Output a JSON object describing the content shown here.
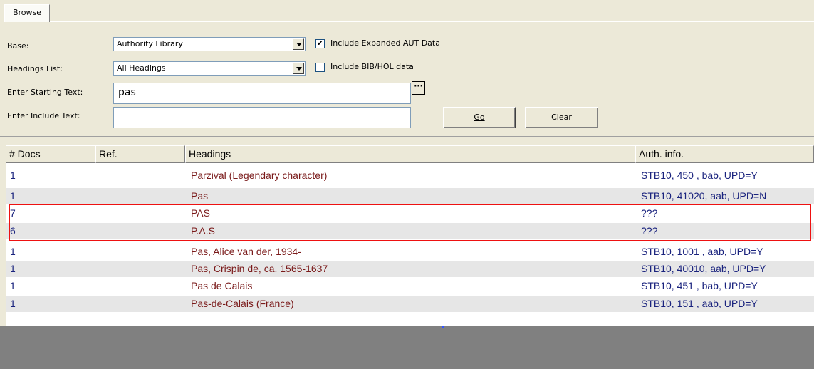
{
  "tabs": [
    "Browse"
  ],
  "form": {
    "base_label": "Base:",
    "base_value": "Authority Library",
    "headings_label": "Headings List:",
    "headings_value": "All Headings",
    "start_label": "Enter Starting Text:",
    "start_value": "pas",
    "include_label": "Enter Include Text:",
    "include_value": "",
    "chk_expanded_label": "Include Expanded AUT Data",
    "chk_expanded_checked": true,
    "chk_bib_label": "Include BIB/HOL data",
    "chk_bib_checked": false,
    "go_label": "Go",
    "clear_label": "Clear"
  },
  "grid": {
    "columns": [
      "# Docs",
      "Ref.",
      "Headings",
      "Auth. info."
    ],
    "rows": [
      {
        "docs": "1",
        "ref": "",
        "heading": "Parzival (Legendary character)",
        "auth": "STB10, 450 , bab, UPD=Y"
      },
      {
        "docs": "1",
        "ref": "",
        "heading": "Pas",
        "auth": "STB10, 41020, aab, UPD=N"
      },
      {
        "docs": "7",
        "ref": "",
        "heading": "PAS",
        "auth": "???"
      },
      {
        "docs": "6",
        "ref": "",
        "heading": "P.A.S",
        "auth": "???"
      },
      {
        "docs": "1",
        "ref": "",
        "heading": "Pas, Alice van der, 1934-",
        "auth": "STB10, 1001 , aab, UPD=Y"
      },
      {
        "docs": "1",
        "ref": "",
        "heading": "Pas, Crispin de, ca. 1565-1637",
        "auth": "STB10, 40010, aab, UPD=Y"
      },
      {
        "docs": "1",
        "ref": "",
        "heading": "Pas de Calais",
        "auth": "STB10, 451 , bab, UPD=Y"
      },
      {
        "docs": "1",
        "ref": "",
        "heading": "Pas-de-Calais (France)",
        "auth": "STB10, 151 , aab, UPD=Y"
      }
    ]
  },
  "colors": {
    "highlight": "#ee1111",
    "heading_text": "#7a1a1a",
    "docs_text": "#1a237e"
  }
}
